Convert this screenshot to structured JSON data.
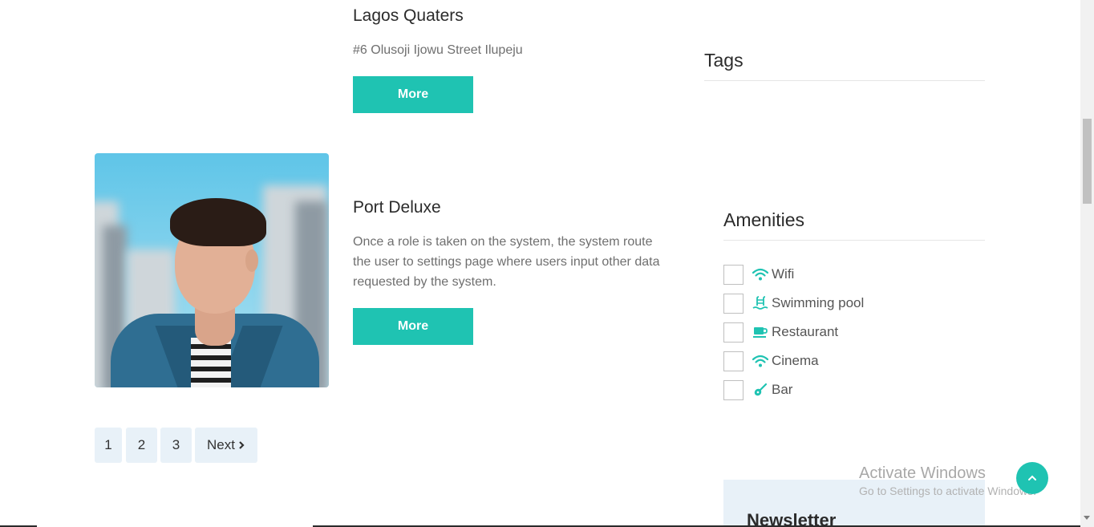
{
  "listings": [
    {
      "title": "Lagos Quaters",
      "text": "#6 Olusoji Ijowu Street Ilupeju",
      "button": "More"
    },
    {
      "title": "Port Deluxe",
      "text": "Once a role is taken on the system, the system route the user to settings page where users input other data requested by the system.",
      "button": "More"
    }
  ],
  "sidebar": {
    "tags_title": "Tags",
    "amenities_title": "Amenities",
    "amenities": [
      {
        "label": "Wifi",
        "icon": "wifi-icon",
        "checked": false
      },
      {
        "label": "Swimming pool",
        "icon": "swimming-pool-icon",
        "checked": false
      },
      {
        "label": "Restaurant",
        "icon": "coffee-cup-icon",
        "checked": false
      },
      {
        "label": "Cinema",
        "icon": "wifi-icon",
        "checked": false
      },
      {
        "label": "Bar",
        "icon": "guitar-icon",
        "checked": false
      }
    ],
    "newsletter_title": "Newsletter"
  },
  "pagination": {
    "pages": [
      "1",
      "2",
      "3"
    ],
    "next_label": "Next"
  },
  "watermark": {
    "title": "Activate Windows",
    "subtitle": "Go to Settings to activate Windows."
  },
  "colors": {
    "accent": "#1fc3b2",
    "light_panel": "#e8f1f8",
    "text_dark": "#2b2b2b",
    "text_muted": "#6f6f6f"
  }
}
